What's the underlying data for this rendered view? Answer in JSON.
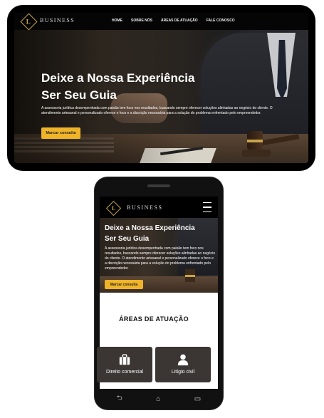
{
  "desktop": {
    "brand_initial": "L",
    "brand_name": "BUSINESS",
    "nav": [
      "HOME",
      "SOBRE NÓS",
      "ÁREAS DE ATUAÇÃO",
      "FALE CONOSCO"
    ],
    "hero_title_line1": "Deixe a Nossa Experiência",
    "hero_title_line2": "Ser Seu Guia",
    "hero_description": "A assessoria jurídica desempenhada com paixão tem foco nos resultados, buscando sempre oferecer soluções alinhadas ao negócio do cliente. O atendimento artesanal e personalizado oferece o foco e a discrição necessária para a solução do problema enfrentado pelo empreendedor.",
    "cta_label": "Marcar consulta"
  },
  "mobile": {
    "brand_initial": "L",
    "brand_name": "BUSINESS",
    "hero_title_line1": "Deixe a Nossa Experiência",
    "hero_title_line2": "Ser Seu Guia",
    "hero_description": "A assessoria jurídica desempenhada com paixão tem foco nos resultados, buscando sempre oferecer soluções alinhadas ao negócio do cliente. O atendimento artesanal e personalizado oferece o foco e a discrição necessária para a solução do problema enfrentado pelo empreendedor.",
    "cta_label": "Marcar consulta",
    "areas_heading": "ÁREAS DE ATUAÇÃO",
    "cards": [
      {
        "label": "Direito comercial",
        "icon": "briefcase-icon"
      },
      {
        "label": "Litígio civil",
        "icon": "person-icon"
      }
    ],
    "system_buttons": [
      "back-icon",
      "home-icon",
      "recents-icon"
    ]
  },
  "colors": {
    "accent": "#f0b429",
    "gold": "#c9a54a",
    "card_bg": "#3b3633",
    "frame": "#000000"
  }
}
